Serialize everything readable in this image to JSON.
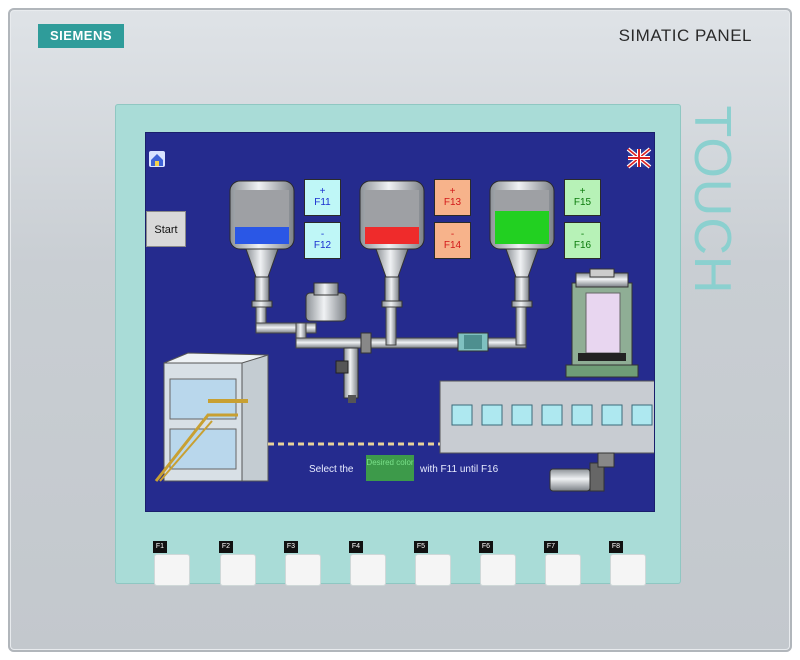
{
  "panel": {
    "logo": "SIEMENS",
    "model": "SIMATIC PANEL",
    "touch_label": "TOUCH"
  },
  "screen": {
    "start_label": "Start",
    "tank_buttons": [
      {
        "sign": "+",
        "key": "F11",
        "color": "#bff7f7"
      },
      {
        "sign": "-",
        "key": "F12",
        "color": "#bff7f7"
      },
      {
        "sign": "+",
        "key": "F13",
        "color": "#f7b38b"
      },
      {
        "sign": "-",
        "key": "F14",
        "color": "#f7b38b"
      },
      {
        "sign": "+",
        "key": "F15",
        "color": "#b7f2b7"
      },
      {
        "sign": "-",
        "key": "F16",
        "color": "#b7f2b7"
      }
    ],
    "tanks": [
      {
        "fill_color": "#2a57e6",
        "level": 0.32
      },
      {
        "fill_color": "#ef2b2b",
        "level": 0.32
      },
      {
        "fill_color": "#22d021",
        "level": 0.62
      }
    ],
    "message_prefix": "Select the",
    "message_highlight": "Desired color",
    "message_suffix": "with F11 until F16",
    "icons": [
      "home-icon",
      "language-flag-icon"
    ]
  },
  "function_keys": [
    "F1",
    "F2",
    "F3",
    "F4",
    "F5",
    "F6",
    "F7",
    "F8"
  ]
}
